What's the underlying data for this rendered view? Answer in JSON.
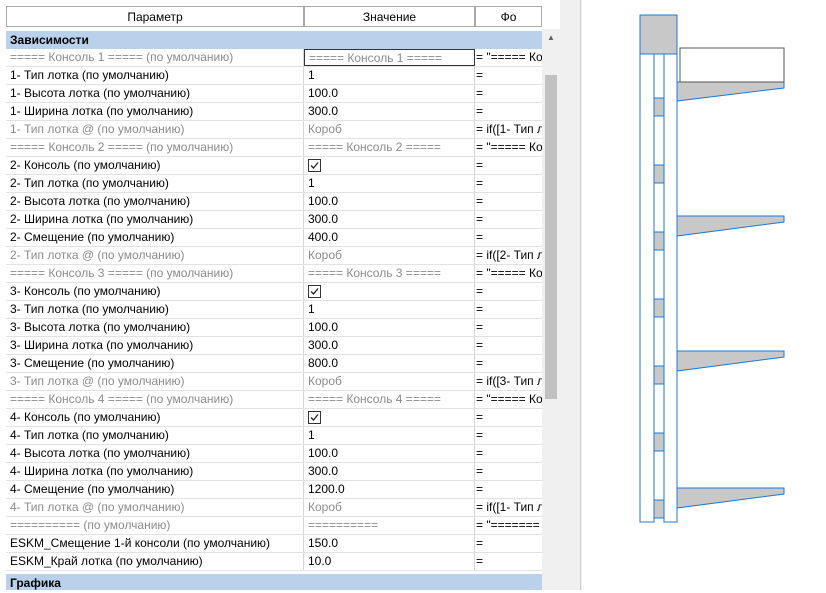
{
  "grid": {
    "headers": {
      "param": "Параметр",
      "value": "Значение",
      "formula": "Фо"
    },
    "group_dependencies": "Зависимости",
    "group_graphics": "Графика",
    "rows": [
      {
        "p": "===== Консоль 1 ===== (по умолчанию)",
        "v": "===== Консоль 1 =====",
        "f": "= \"===== Ко",
        "dim": true,
        "sel": true
      },
      {
        "p": "1- Тип лотка (по умолчанию)",
        "v": "1",
        "f": "="
      },
      {
        "p": "1- Высота лотка (по умолчанию)",
        "v": "100.0",
        "f": "="
      },
      {
        "p": "1- Ширина лотка (по умолчанию)",
        "v": "300.0",
        "f": "="
      },
      {
        "p": "1- Тип лотка @ (по умолчанию)",
        "v": "Короб",
        "f": "= if([1- Тип л",
        "dim": true
      },
      {
        "p": "===== Консоль 2 ===== (по умолчанию)",
        "v": "===== Консоль 2 =====",
        "f": "= \"===== Ко",
        "dim": true
      },
      {
        "p": "2- Консоль (по умолчанию)",
        "v": "",
        "f": "=",
        "chk": true
      },
      {
        "p": "2- Тип лотка (по умолчанию)",
        "v": "1",
        "f": "="
      },
      {
        "p": "2- Высота лотка (по умолчанию)",
        "v": "100.0",
        "f": "="
      },
      {
        "p": "2- Ширина лотка (по умолчанию)",
        "v": "300.0",
        "f": "="
      },
      {
        "p": "2- Смещение (по умолчанию)",
        "v": "400.0",
        "f": "="
      },
      {
        "p": "2- Тип лотка @ (по умолчанию)",
        "v": "Короб",
        "f": "= if([2- Тип л",
        "dim": true
      },
      {
        "p": "===== Консоль 3 ===== (по умолчанию)",
        "v": "===== Консоль 3 =====",
        "f": "= \"===== Ко",
        "dim": true
      },
      {
        "p": "3- Консоль (по умолчанию)",
        "v": "",
        "f": "=",
        "chk": true
      },
      {
        "p": "3- Тип лотка (по умолчанию)",
        "v": "1",
        "f": "="
      },
      {
        "p": "3- Высота лотка (по умолчанию)",
        "v": "100.0",
        "f": "="
      },
      {
        "p": "3- Ширина лотка (по умолчанию)",
        "v": "300.0",
        "f": "="
      },
      {
        "p": "3- Смещение (по умолчанию)",
        "v": "800.0",
        "f": "="
      },
      {
        "p": "3- Тип лотка @ (по умолчанию)",
        "v": "Короб",
        "f": "= if([3- Тип л",
        "dim": true
      },
      {
        "p": "===== Консоль 4 ===== (по умолчанию)",
        "v": "===== Консоль 4 =====",
        "f": "= \"===== Ко",
        "dim": true
      },
      {
        "p": "4- Консоль (по умолчанию)",
        "v": "",
        "f": "=",
        "chk": true
      },
      {
        "p": "4- Тип лотка (по умолчанию)",
        "v": "1",
        "f": "="
      },
      {
        "p": "4- Высота лотка (по умолчанию)",
        "v": "100.0",
        "f": "="
      },
      {
        "p": "4- Ширина лотка (по умолчанию)",
        "v": "300.0",
        "f": "="
      },
      {
        "p": "4- Смещение (по умолчанию)",
        "v": "1200.0",
        "f": "="
      },
      {
        "p": "4- Тип лотка @ (по умолчанию)",
        "v": "Короб",
        "f": "= if([1- Тип л",
        "dim": true
      },
      {
        "p": "========== (по умолчанию)",
        "v": "==========",
        "f": "= \"=======",
        "dim": true
      },
      {
        "p": "ESKM_Смещение 1-й консоли (по умолчанию)",
        "v": "150.0",
        "f": "="
      },
      {
        "p": "ESKM_Край лотка (по умолчанию)",
        "v": "10.0",
        "f": "="
      }
    ]
  },
  "colors": {
    "group_bg": "#b9d1ea",
    "model_fill": "#c8c8c8",
    "model_edge": "#1e78d7"
  }
}
